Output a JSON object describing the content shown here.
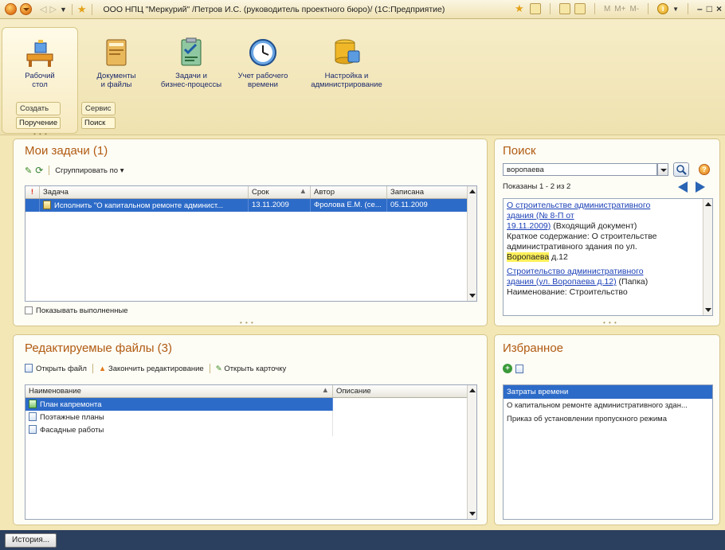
{
  "window": {
    "title": "ООО НПЦ \"Меркурий\" /Петров И.С. (руководитель проектного бюро)/  (1С:Предприятие)",
    "memory_buttons": [
      "M",
      "M+",
      "M-"
    ]
  },
  "sections": [
    {
      "label1": "Рабочий",
      "label2": "стол",
      "icon": "desktop-icon"
    },
    {
      "label1": "Документы",
      "label2": "и файлы",
      "icon": "folder-icon"
    },
    {
      "label1": "Задачи и",
      "label2": "бизнес-процессы",
      "icon": "tasks-icon"
    },
    {
      "label1": "Учет рабочего",
      "label2": "времени",
      "icon": "clock-icon"
    },
    {
      "label1": "Настройка и",
      "label2": "администрирование",
      "icon": "database-icon"
    }
  ],
  "command_groups": [
    {
      "caption": "Создать",
      "button": "Поручение"
    },
    {
      "caption": "Сервис",
      "button": "Поиск"
    }
  ],
  "tasks_panel": {
    "title": "Мои задачи (1)",
    "group_by": "Сгруппировать по",
    "columns": [
      "Задача",
      "Срок",
      "Автор",
      "Записана"
    ],
    "rows": [
      {
        "task": "Исполнить \"О капитальном ремонте админист...",
        "due": "13.11.2009",
        "author": "Фролова Е.М. (се...",
        "recorded": "05.11.2009"
      }
    ],
    "show_completed": "Показывать выполненные"
  },
  "files_panel": {
    "title": "Редактируемые файлы (3)",
    "open_file": "Открыть файл",
    "finish_editing": "Закончить редактирование",
    "open_card": "Открыть карточку",
    "columns": [
      "Наименование",
      "Описание"
    ],
    "rows": [
      {
        "name": "План капремонта",
        "desc": ""
      },
      {
        "name": "Поэтажные планы",
        "desc": ""
      },
      {
        "name": "Фасадные работы",
        "desc": ""
      }
    ]
  },
  "search_panel": {
    "title": "Поиск",
    "query": "воропаева",
    "shown": "Показаны 1 - 2 из 2",
    "r1_link1": "О строительстве административного",
    "r1_link2": "здания (№ 8-П от",
    "r1_link3": "19.11.2009)",
    "r1_type": " (Входящий документ)",
    "r1_text1": "Краткое содержание: О строительстве",
    "r1_text2": "административного здания по ул.",
    "r1_hl": "Воропаева",
    "r1_tail": " д.12",
    "r2_link1": "Строительство административного",
    "r2_link2": "здания (ул. Воропаева д.12)",
    "r2_type": " (Папка)",
    "r2_text1": "Наименование: Строительство"
  },
  "favorites_panel": {
    "title": "Избранное",
    "items": [
      "Затраты времени",
      "О капитальном ремонте административного здан...",
      "Приказ об установлении пропускного режима"
    ]
  },
  "statusbar": {
    "history": "История..."
  }
}
